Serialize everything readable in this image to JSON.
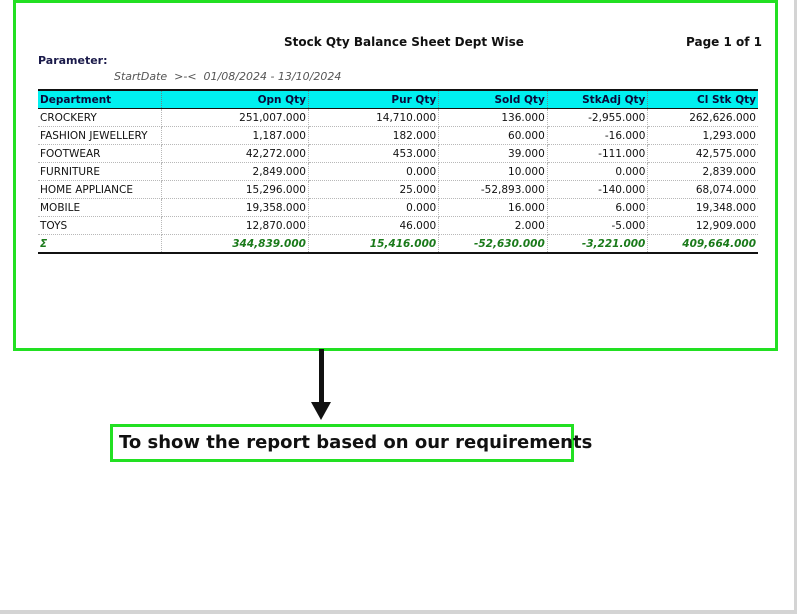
{
  "report": {
    "title": "Stock Qty Balance Sheet Dept Wise",
    "page_label": "Page 1 of 1",
    "parameter_label": "Parameter:",
    "param_line": "StartDate  >-<  01/08/2024 - 13/10/2024"
  },
  "table": {
    "headers": {
      "department": "Department",
      "opn_qty": "Opn Qty",
      "pur_qty": "Pur Qty",
      "sold_qty": "Sold Qty",
      "stkadj_qty": "StkAdj Qty",
      "cl_stk_qty": "Cl Stk Qty"
    },
    "rows": [
      {
        "department": "CROCKERY",
        "opn": "251,007.000",
        "pur": "14,710.000",
        "sold": "136.000",
        "adj": "-2,955.000",
        "cl": "262,626.000"
      },
      {
        "department": "FASHION JEWELLERY",
        "opn": "1,187.000",
        "pur": "182.000",
        "sold": "60.000",
        "adj": "-16.000",
        "cl": "1,293.000"
      },
      {
        "department": "FOOTWEAR",
        "opn": "42,272.000",
        "pur": "453.000",
        "sold": "39.000",
        "adj": "-111.000",
        "cl": "42,575.000"
      },
      {
        "department": "FURNITURE",
        "opn": "2,849.000",
        "pur": "0.000",
        "sold": "10.000",
        "adj": "0.000",
        "cl": "2,839.000"
      },
      {
        "department": "HOME APPLIANCE",
        "opn": "15,296.000",
        "pur": "25.000",
        "sold": "-52,893.000",
        "adj": "-140.000",
        "cl": "68,074.000"
      },
      {
        "department": "MOBILE",
        "opn": "19,358.000",
        "pur": "0.000",
        "sold": "16.000",
        "adj": "6.000",
        "cl": "19,348.000"
      },
      {
        "department": "TOYS",
        "opn": "12,870.000",
        "pur": "46.000",
        "sold": "2.000",
        "adj": "-5.000",
        "cl": "12,909.000"
      }
    ],
    "totals": {
      "symbol": "Σ",
      "opn": "344,839.000",
      "pur": "15,416.000",
      "sold": "-52,630.000",
      "adj": "-3,221.000",
      "cl": "409,664.000"
    }
  },
  "callout": {
    "text": "To show the report based on our requirements"
  },
  "colors": {
    "highlight_border": "#22e022",
    "header_bg": "#00f0f0",
    "total_text": "#1a7a1a"
  }
}
